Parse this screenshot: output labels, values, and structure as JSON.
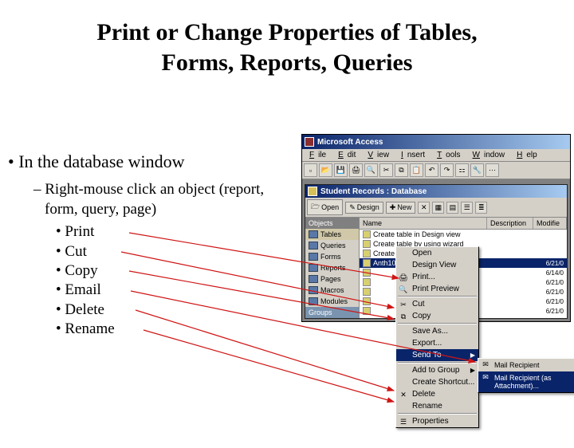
{
  "slide": {
    "title_line1": "Print or Change Properties of Tables,",
    "title_line2": "Forms, Reports, Queries",
    "bullet_main": "In the database window",
    "sub_dash": "– Right-mouse click an object (report, form, query, page)",
    "sub_bullets": [
      "Print",
      "Cut",
      "Copy",
      "Email",
      "Delete",
      "Rename"
    ]
  },
  "app": {
    "title": "Microsoft Access",
    "menus": [
      "File",
      "Edit",
      "View",
      "Insert",
      "Tools",
      "Window",
      "Help"
    ],
    "child_title": "Student Records : Database",
    "childbar": {
      "open": "Open",
      "design": "Design",
      "new": "New"
    },
    "objhdr": "Objects",
    "objitems": [
      "Tables",
      "Queries",
      "Forms",
      "Reports",
      "Pages",
      "Macros",
      "Modules"
    ],
    "groups": "Groups",
    "list_headers": {
      "name": "Name",
      "desc": "Description",
      "mod": "Modifie"
    },
    "list_rows": [
      {
        "name": "Create table in Design view",
        "date": ""
      },
      {
        "name": "Create table by using wizard",
        "date": ""
      },
      {
        "name": "Create table by entering data",
        "date": ""
      },
      {
        "name": "Anth100address",
        "date": "6/21/0"
      },
      {
        "name": "",
        "date": "6/14/0"
      },
      {
        "name": "",
        "date": "6/21/0"
      },
      {
        "name": "",
        "date": "6/21/0"
      },
      {
        "name": "",
        "date": "6/21/0"
      },
      {
        "name": "",
        "date": "6/21/0"
      }
    ],
    "context_items": [
      {
        "label": "Open",
        "icon": ""
      },
      {
        "label": "Design View",
        "icon": ""
      },
      {
        "label": "Print...",
        "icon": "🖨"
      },
      {
        "label": "Print Preview",
        "icon": "🔍"
      },
      {
        "sep": true
      },
      {
        "label": "Cut",
        "icon": "✂"
      },
      {
        "label": "Copy",
        "icon": "⧉"
      },
      {
        "sep": true
      },
      {
        "label": "Save As...",
        "icon": ""
      },
      {
        "label": "Export...",
        "icon": ""
      },
      {
        "label": "Send To",
        "icon": "",
        "sub": true,
        "sel": true
      },
      {
        "sep": true
      },
      {
        "label": "Add to Group",
        "icon": "",
        "sub": true
      },
      {
        "label": "Create Shortcut...",
        "icon": ""
      },
      {
        "label": "Delete",
        "icon": "✕"
      },
      {
        "label": "Rename",
        "icon": ""
      },
      {
        "sep": true
      },
      {
        "label": "Properties",
        "icon": "☰"
      }
    ],
    "submenu": [
      {
        "label": "Mail Recipient",
        "icon": "✉"
      },
      {
        "label": "Mail Recipient (as Attachment)...",
        "icon": "✉",
        "sel": true
      }
    ]
  }
}
